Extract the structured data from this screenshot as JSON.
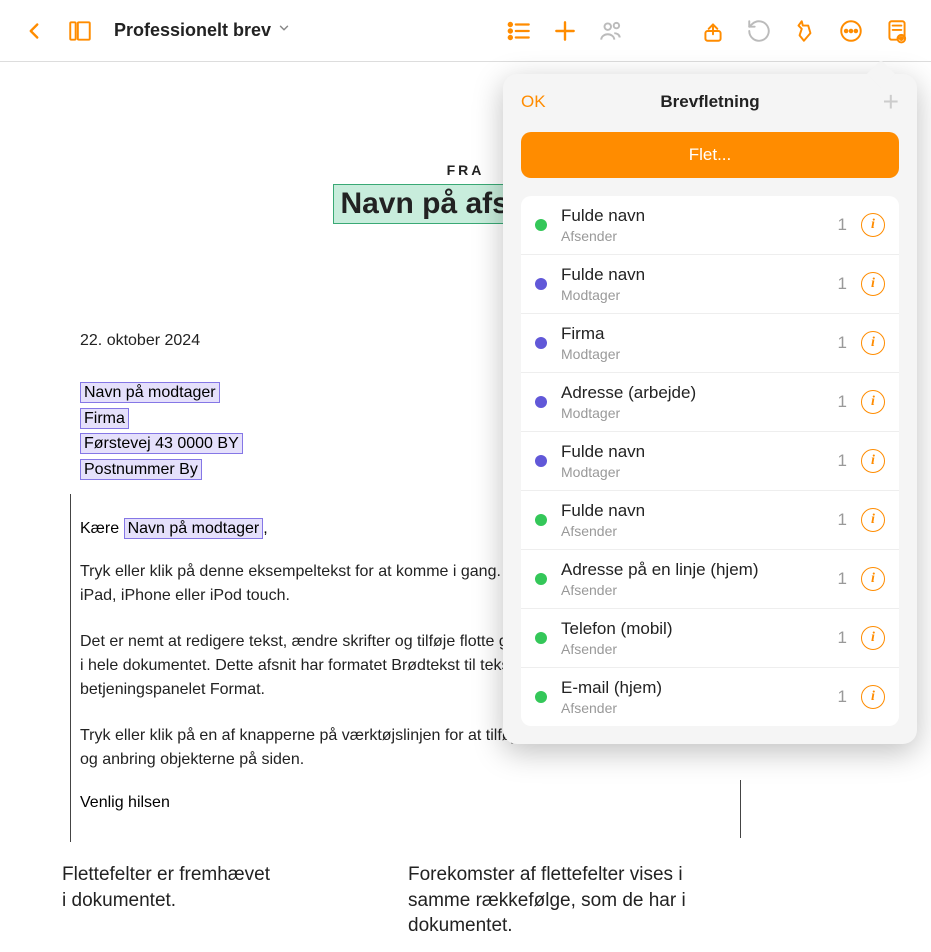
{
  "toolbar": {
    "doc_title": "Professionelt brev"
  },
  "document": {
    "from_label": "FRA",
    "sender_name": "Navn på afsender",
    "date": "22. oktober 2024",
    "recipient_name": "Navn på modtager",
    "company": "Firma",
    "address": "Førstevej 43 0000 BY",
    "postal_city": "Postnummer By",
    "salutation_prefix": "Kære ",
    "salutation_field": "Navn på modtager",
    "salutation_suffix": ",",
    "p1": "Tryk eller klik på denne eksempeltekst for at komme i gang. Du kan redigere dette dokument på din Mac, iPad, iPhone eller iPod touch.",
    "p2": "Det er nemt at redigere tekst, ændre skrifter og tilføje flotte grafikelementer for at opnå et ensartet udseende i hele dokumentet. Dette afsnit har formatet Brødtekst til tekst. Du kan ændre det på fanen Tekst under betjeningspanelet Format.",
    "p3": "Tryk eller klik på en af knapperne på værktøjslinjen for at tilføje tabeller, diagrammer og objekter, eller træk og anbring objekterne på siden.",
    "closing": "Venlig hilsen"
  },
  "popover": {
    "ok": "OK",
    "title": "Brevfletning",
    "merge_button": "Flet...",
    "items": [
      {
        "name": "Fulde navn",
        "role": "Afsender",
        "count": "1",
        "color": "green"
      },
      {
        "name": "Fulde navn",
        "role": "Modtager",
        "count": "1",
        "color": "purple"
      },
      {
        "name": "Firma",
        "role": "Modtager",
        "count": "1",
        "color": "purple"
      },
      {
        "name": "Adresse (arbejde)",
        "role": "Modtager",
        "count": "1",
        "color": "purple"
      },
      {
        "name": "Fulde navn",
        "role": "Modtager",
        "count": "1",
        "color": "purple"
      },
      {
        "name": "Fulde navn",
        "role": "Afsender",
        "count": "1",
        "color": "green"
      },
      {
        "name": "Adresse på en linje (hjem)",
        "role": "Afsender",
        "count": "1",
        "color": "green"
      },
      {
        "name": "Telefon (mobil)",
        "role": "Afsender",
        "count": "1",
        "color": "green"
      },
      {
        "name": "E-mail (hjem)",
        "role": "Afsender",
        "count": "1",
        "color": "green"
      }
    ]
  },
  "callouts": {
    "left": "Flettefelter er fremhævet i dokumentet.",
    "right": "Forekomster af flettefelter vises i samme rækkefølge, som de har i dokumentet."
  }
}
